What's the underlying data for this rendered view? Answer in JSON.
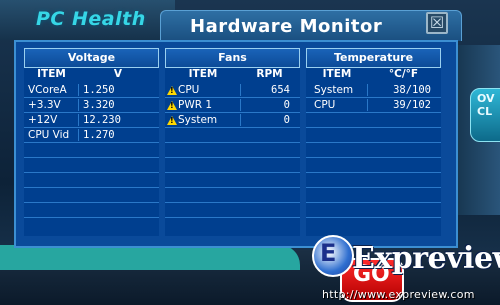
{
  "app": {
    "title": "PC Health",
    "window_title": "Hardware Monitor",
    "close_glyph": "☒"
  },
  "side_button": {
    "label_line1": "OV",
    "label_line2": "CL"
  },
  "go_button": {
    "label": "GO"
  },
  "voltage": {
    "title": "Voltage",
    "col_item": "ITEM",
    "col_value": "V",
    "rows": [
      {
        "item": "VCoreA",
        "value": "1.250"
      },
      {
        "item": "+3.3V",
        "value": "3.320"
      },
      {
        "item": "+12V",
        "value": "12.230"
      },
      {
        "item": "CPU Vid",
        "value": "1.270"
      }
    ]
  },
  "fans": {
    "title": "Fans",
    "col_item": "ITEM",
    "col_value": "RPM",
    "warning_icon": "warning-icon",
    "rows": [
      {
        "item": "CPU",
        "value": "654"
      },
      {
        "item": "PWR 1",
        "value": "0"
      },
      {
        "item": "System",
        "value": "0"
      }
    ]
  },
  "temperature": {
    "title": "Temperature",
    "col_item": "ITEM",
    "col_value": "°C/°F",
    "rows": [
      {
        "item": "System",
        "value": "38/100"
      },
      {
        "item": "CPU",
        "value": "39/102"
      }
    ]
  },
  "watermark": {
    "brand": "Expreview",
    "logo_letter": "E",
    "url": "http://www.expreview.com"
  },
  "colors": {
    "accent": "#36d6e6",
    "panel": "#0a4a9a",
    "warning": "#ffd800"
  }
}
